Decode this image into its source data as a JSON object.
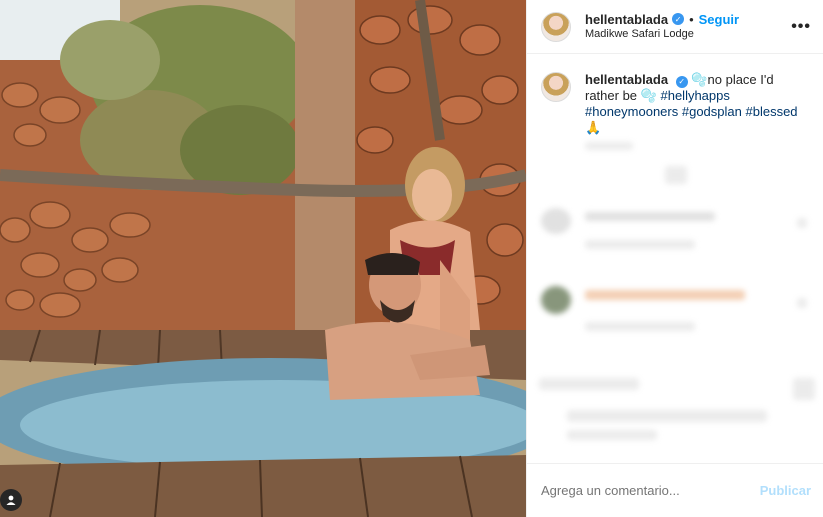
{
  "post": {
    "username": "hellentablada",
    "follow_label": "Seguir",
    "location": "Madikwe Safari Lodge",
    "more_label": "•••",
    "verified_glyph": "✓"
  },
  "caption": {
    "username": "hellentablada",
    "text": "no place I'd rather be",
    "emoji": "🫧",
    "hashtags": [
      "#hellyhapps",
      "#honeymooners",
      "#godsplan",
      "#blessed"
    ],
    "end_emoji": "🙏"
  },
  "comment_box": {
    "placeholder": "Agrega un comentario...",
    "publish_label": "Publicar"
  },
  "icons": {
    "verified": "verified-badge-icon",
    "user_tag": "user-tag-icon",
    "more": "more-options-icon"
  },
  "colors": {
    "link": "#0095f6",
    "hashtag": "#00376b",
    "publish_disabled": "#b2dffc",
    "verified": "#3897f0"
  }
}
